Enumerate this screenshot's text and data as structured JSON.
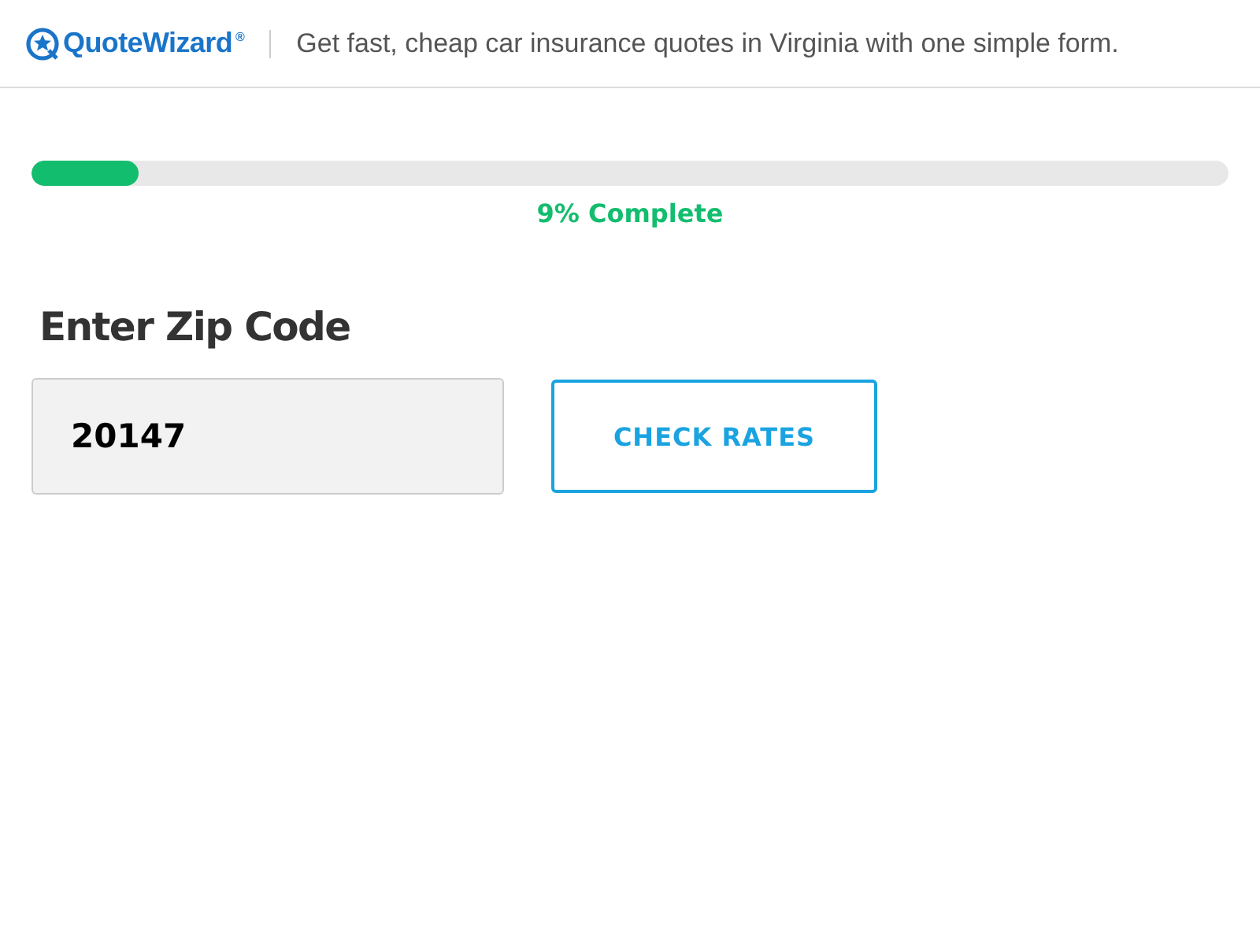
{
  "header": {
    "logo": {
      "name": "QuoteWizard",
      "mark": "®"
    },
    "tagline": "Get fast, cheap car insurance quotes in Virginia with one simple form."
  },
  "progress": {
    "level": 0.09,
    "label": "9% Complete"
  },
  "form": {
    "heading": "Enter Zip Code",
    "zip_field": {
      "value": "20147"
    },
    "button": "CHECK RATES"
  }
}
